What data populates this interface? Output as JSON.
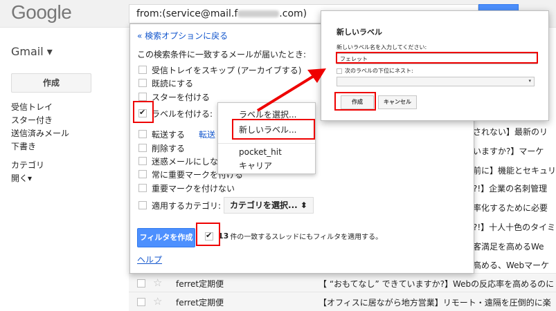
{
  "header": {
    "logo": "Google",
    "search_prefix": "from:(service@mail.f",
    "search_middle": "ferret-plus",
    "search_suffix": ".com)"
  },
  "nav": {
    "app_title": "Gmail ▾",
    "compose_label": "作成",
    "items": [
      "受信トレイ",
      "スター付き",
      "送信済みメール",
      "下書き"
    ],
    "items2": [
      "カテゴリ",
      "開く▾"
    ]
  },
  "filter": {
    "back_link": "« 検索オプションに戻る",
    "criteria": "この検索条件に一致するメールが届いたとき:",
    "options": {
      "skip_inbox": "受信トレイをスキップ (アーカイブする)",
      "mark_read": "既読にする",
      "star": "スターを付ける",
      "apply_label": "ラベルを付ける:",
      "forward": "転送する",
      "forward_link": "転送",
      "delete": "削除する",
      "never_spam": "迷惑メールにしない",
      "always_important": "常に重要マークを付ける",
      "never_important": "重要マークを付けない",
      "category": "適用するカテゴリ:"
    },
    "category_select": "カテゴリを選択... ⬍",
    "create_button": "フィルタを作成",
    "apply_count": "13",
    "apply_text": "件の一致するスレッドにもフィルタを適用する。",
    "help_link": "ヘルプ"
  },
  "label_menu": {
    "choose": "ラベルを選択...",
    "new_label": "新しいラベル...",
    "labels": [
      "pocket_hit",
      "キャリア"
    ]
  },
  "dialog": {
    "title": "新しいラベル",
    "prompt": "新しいラベル名を入力してください:",
    "input_value": "フェレット",
    "nest_label": "次のラベルの下位にネスト:",
    "select_arrow": "▾",
    "create_button": "作成",
    "cancel_button": "キャンセル"
  },
  "background_snippets": [
    "されない】最新のリ",
    "いますか?】マーケ",
    "前に】機能とセキュリ",
    "?!】企業の名刺管理",
    "率化するために必要",
    "?!】十人十色のタイミ",
    "客満足を高めるWe",
    "高める、Webマーケ"
  ],
  "mail_rows": [
    {
      "sender": "ferret定期便",
      "subject": "【 “おもてなし” できていますか?】Webの反応率を高めるのに"
    },
    {
      "sender": "ferret定期便",
      "subject": "【オフィスに居ながら地方営業】リモート・遠隔を圧倒的に楽"
    }
  ],
  "colors": {
    "link": "#1155cc",
    "primary_button": "#4d90fe",
    "highlight": "#ee0000"
  }
}
